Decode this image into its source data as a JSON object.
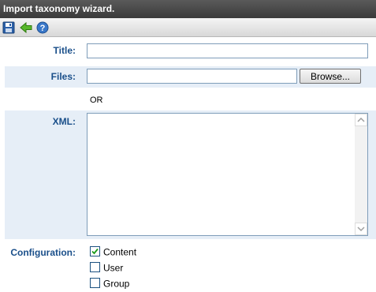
{
  "window": {
    "title": "Import taxonomy wizard."
  },
  "toolbar": {
    "icons": [
      "save-icon",
      "back-arrow-icon",
      "help-icon"
    ]
  },
  "form": {
    "title_label": "Title:",
    "title_value": "",
    "files_label": "Files:",
    "files_value": "",
    "browse_label": "Browse...",
    "or_text": "OR",
    "xml_label": "XML:",
    "xml_value": "",
    "configuration_label": "Configuration:",
    "options": [
      {
        "label": "Content",
        "checked": true
      },
      {
        "label": "User",
        "checked": false
      },
      {
        "label": "Group",
        "checked": false
      }
    ]
  },
  "colors": {
    "label": "#1a4f8a",
    "row_highlight": "#e6eef7",
    "titlebar": "#3a3a3a"
  }
}
